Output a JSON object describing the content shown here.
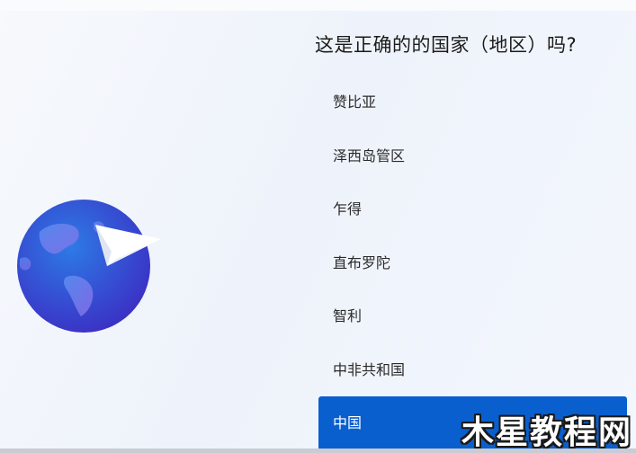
{
  "setup": {
    "title": "这是正确的的国家（地区）吗?",
    "regions": [
      "赞比亚",
      "泽西岛管区",
      "乍得",
      "直布罗陀",
      "智利",
      "中非共和国",
      "中国"
    ],
    "selected_index": 6,
    "accent_color": "#0a5fcf"
  },
  "watermark": {
    "text": "木星教程网"
  },
  "illustration": {
    "icon": "globe-paper-plane-icon"
  }
}
